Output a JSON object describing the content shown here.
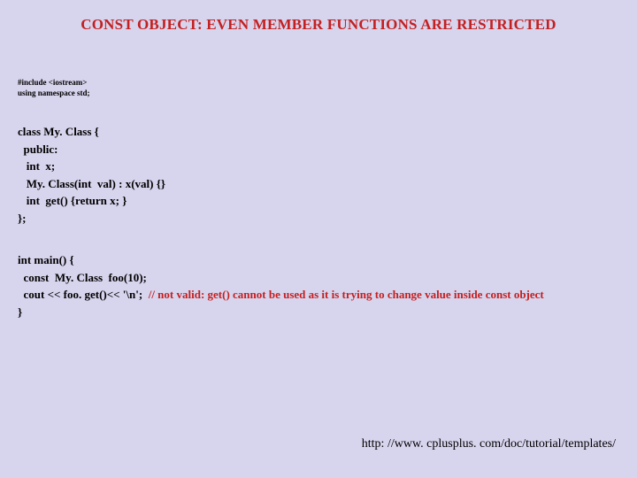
{
  "title": "CONST OBJECT: EVEN MEMBER FUNCTIONS ARE RESTRICTED",
  "includes": {
    "line1": "#include <iostream>",
    "line2": "using namespace std;"
  },
  "class_code": {
    "l1": "class My. Class {",
    "l2": "  public:",
    "l3": "   int  x;",
    "l4": "   My. Class(int  val) : x(val) {}",
    "l5": "   int  get() {return x; }",
    "l6": "};"
  },
  "main_code": {
    "l1": "int main() {",
    "l2": "  const  My. Class  foo(10);",
    "l3_a": "  cout << foo. get()<< '\\n';  ",
    "l3_b": "// not valid: get() cannot be used as it is trying to change value inside const object",
    "l4": "}"
  },
  "footer_url": "http: //www. cplusplus. com/doc/tutorial/templates/"
}
